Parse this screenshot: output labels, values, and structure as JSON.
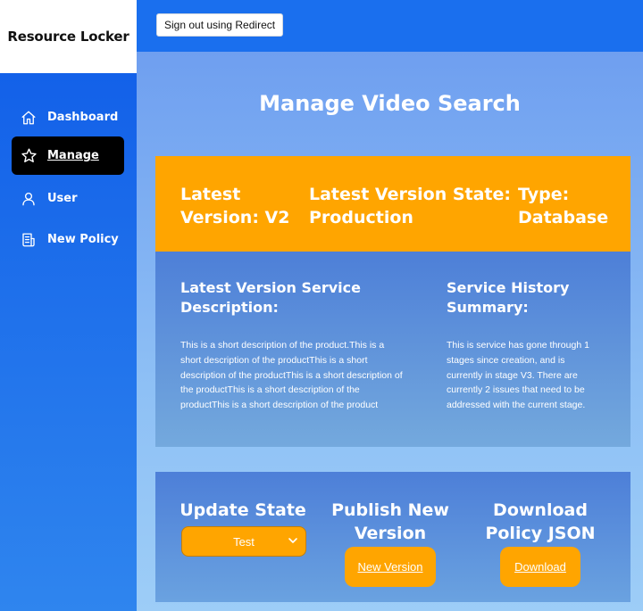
{
  "app": {
    "brand": "Resource Locker"
  },
  "header": {
    "signout_label": "Sign out using Redirect"
  },
  "sidebar": {
    "items": [
      {
        "label": "Dashboard",
        "icon": "home-icon"
      },
      {
        "label": "Manage",
        "icon": "star-icon",
        "active": true
      },
      {
        "label": "User",
        "icon": "user-icon"
      },
      {
        "label": "New Policy",
        "icon": "document-icon"
      }
    ]
  },
  "page": {
    "title": "Manage Video Search"
  },
  "summary": {
    "version_line1": "Latest",
    "version_line2": "Version: V2",
    "state_line1": "Latest Version State:",
    "state_line2": "Production",
    "type_line1": "Type:",
    "type_line2": "Database"
  },
  "details": {
    "desc_heading_line1": "Latest Version Service",
    "desc_heading_line2": "Description:",
    "desc_lines": [
      "This is a short description of the product.This is a",
      "short description of the productThis is a short",
      "description of the productThis is a short description of",
      "the productThis is a short description of the",
      "productThis is a short description of the product"
    ],
    "history_heading_line1": "Service History",
    "history_heading_line2": "Summary:",
    "history_lines": [
      "This is service has gone through 1",
      "stages since creation, and is",
      "currently in stage V3. There are",
      "currently 2 issues that need to be",
      "addressed with the current stage."
    ]
  },
  "actions": {
    "update_heading": "Update State",
    "update_selected": "Test",
    "publish_heading_line1": "Publish New",
    "publish_heading_line2": "Version",
    "publish_button": "New Version",
    "download_heading_line1": "Download",
    "download_heading_line2": "Policy JSON",
    "download_button": "Download"
  },
  "colors": {
    "accent": "#ffa500",
    "sidebar": "#1a6fee",
    "active_nav": "#000000"
  }
}
